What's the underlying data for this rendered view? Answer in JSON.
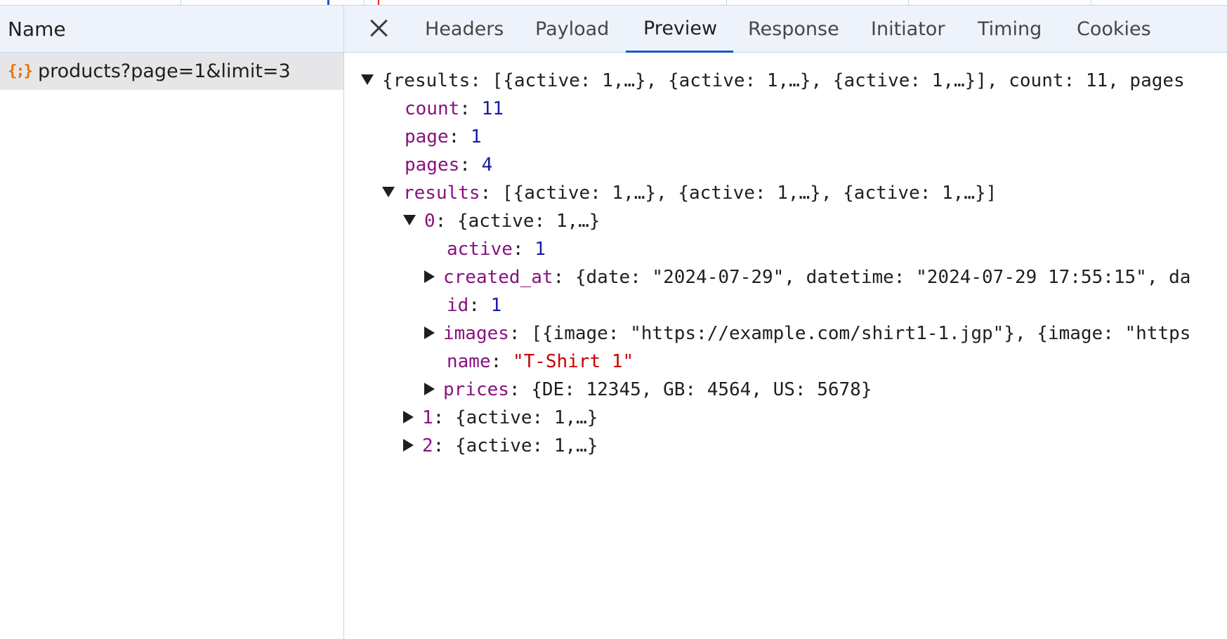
{
  "request_list": {
    "header": "Name",
    "rows": [
      {
        "name": "products?page=1&limit=3",
        "icon": "json-braces-icon"
      }
    ]
  },
  "tabs": [
    {
      "label": "Headers"
    },
    {
      "label": "Payload"
    },
    {
      "label": "Preview",
      "active": true
    },
    {
      "label": "Response"
    },
    {
      "label": "Initiator"
    },
    {
      "label": "Timing"
    },
    {
      "label": "Cookies"
    }
  ],
  "preview": {
    "root_summary": "{results: [{active: 1,…}, {active: 1,…}, {active: 1,…}], count: 11, pages",
    "count_key": "count",
    "count_value": "11",
    "page_key": "page",
    "page_value": "1",
    "pages_key": "pages",
    "pages_value": "4",
    "results_key": "results",
    "results_summary": "[{active: 1,…}, {active: 1,…}, {active: 1,…}]",
    "item0_key": "0",
    "item0_summary": "{active: 1,…}",
    "active_key": "active",
    "active_value": "1",
    "created_at_key": "created_at",
    "created_at_summary": "{date: \"2024-07-29\", datetime: \"2024-07-29 17:55:15\", da",
    "id_key": "id",
    "id_value": "1",
    "images_key": "images",
    "images_summary": "[{image: \"https://example.com/shirt1-1.jgp\"}, {image: \"https",
    "name_key": "name",
    "name_value": "\"T-Shirt 1\"",
    "prices_key": "prices",
    "prices_summary": "{DE: 12345, GB: 4564, US: 5678}",
    "item1_key": "1",
    "item1_summary": "{active: 1,…}",
    "item2_key": "2",
    "item2_summary": "{active: 1,…}"
  },
  "colors": {
    "accent": "#1a56c9",
    "key": "#881280",
    "number": "#1a1aa6",
    "string": "#c80000",
    "json_icon": "#e8710a"
  }
}
